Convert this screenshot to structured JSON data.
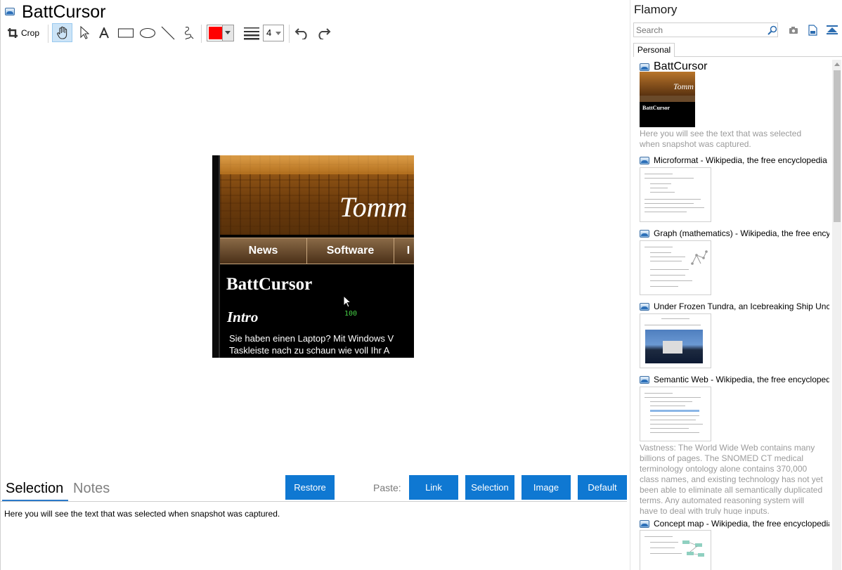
{
  "app": {
    "title": "BattCursor",
    "icon": "app-icon"
  },
  "toolbar": {
    "crop_label": "Crop",
    "tools": [
      "crop-icon",
      "hand-icon",
      "pointer-icon",
      "text-icon",
      "rectangle-icon",
      "ellipse-icon",
      "line-icon",
      "freehand-icon"
    ],
    "color": "#ff0000",
    "line_width": "4",
    "undo_icon": "undo-icon",
    "redo_icon": "redo-icon"
  },
  "snapshot": {
    "banner_text": "Tomm",
    "nav": [
      "News",
      "Software",
      "I"
    ],
    "heading": "BattCursor",
    "subheading": "Intro",
    "cursor_value": "100",
    "paragraph_1": "Sie haben einen Laptop? Mit Windows V",
    "paragraph_2": "Taskleiste nach zu schaun wie voll Ihr A"
  },
  "bottom": {
    "tab_selection": "Selection",
    "tab_notes": "Notes",
    "restore_label": "Restore",
    "paste_label": "Paste:",
    "paste_buttons": [
      "Link",
      "Selection",
      "Image",
      "Default"
    ],
    "selection_text": "Here you will see the text that was selected when snapshot was captured."
  },
  "sidebar": {
    "title": "Flamory",
    "search_placeholder": "Search",
    "tab": "Personal",
    "items": [
      {
        "title": "BattCursor",
        "desc": "Here you will see the text that was selected when snapshot was captured."
      },
      {
        "title": "Microformat - Wikipedia, the free encyclopedia",
        "desc": ""
      },
      {
        "title": "Graph (mathematics) - Wikipedia, the free encyclopedia",
        "desc": ""
      },
      {
        "title": "Under Frozen Tundra, an Icebreaking Ship Uncovers",
        "desc": ""
      },
      {
        "title": "Semantic Web - Wikipedia, the free encyclopedia",
        "desc": "Vastness: The World Wide Web contains many billions of pages. The SNOMED CT medical terminology ontology alone contains 370,000 class names, and existing technology has not yet been able to eliminate all semantically duplicated terms. Any automated reasoning system will have to deal with truly huge inputs."
      },
      {
        "title": "Concept map - Wikipedia, the free encyclopedia",
        "desc": ""
      }
    ]
  },
  "colors": {
    "accent": "#0f78d2",
    "tab_underline": "#2b79c9"
  }
}
